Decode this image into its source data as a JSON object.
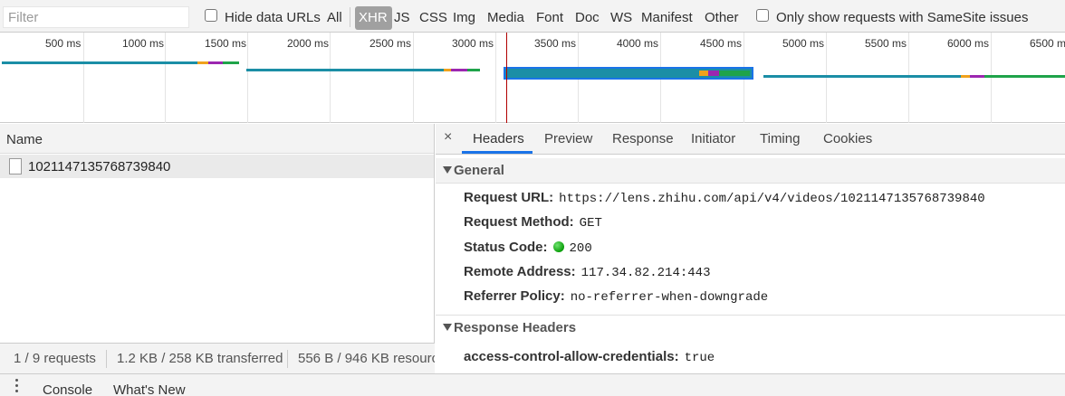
{
  "filter": {
    "placeholder": "Filter",
    "hide_data_urls": "Hide data URLs",
    "types": [
      "All",
      "XHR",
      "JS",
      "CSS",
      "Img",
      "Media",
      "Font",
      "Doc",
      "WS",
      "Manifest",
      "Other"
    ],
    "active_type": "XHR",
    "same_site": "Only show requests with SameSite issues"
  },
  "overview": {
    "ticks": [
      "500 ms",
      "1000 ms",
      "1500 ms",
      "2000 ms",
      "2500 ms",
      "3000 ms",
      "3500 ms",
      "4000 ms",
      "4500 ms",
      "5000 ms",
      "5500 ms",
      "6000 ms",
      "6500 m"
    ]
  },
  "requests": {
    "column_name": "Name",
    "rows": [
      "1021147135768739840"
    ]
  },
  "summary": {
    "requests": "1 / 9 requests",
    "transferred": "1.2 KB / 258 KB transferred",
    "resources": "556 B / 946 KB resourc"
  },
  "details": {
    "close": "×",
    "tabs": [
      "Headers",
      "Preview",
      "Response",
      "Initiator",
      "Timing",
      "Cookies"
    ],
    "active_tab": "Headers",
    "general": {
      "title": "General",
      "fields": [
        {
          "key": "Request URL:",
          "value": "https://lens.zhihu.com/api/v4/videos/1021147135768739840"
        },
        {
          "key": "Request Method:",
          "value": "GET"
        },
        {
          "key": "Status Code:",
          "value": "200"
        },
        {
          "key": "Remote Address:",
          "value": "117.34.82.214:443"
        },
        {
          "key": "Referrer Policy:",
          "value": "no-referrer-when-downgrade"
        }
      ]
    },
    "response_headers": {
      "title": "Response Headers",
      "fields": [
        {
          "key": "access-control-allow-credentials:",
          "value": "true"
        }
      ]
    }
  },
  "drawer": {
    "tabs": [
      "Console",
      "What's New"
    ]
  },
  "colors": {
    "accent": "#1a73e8",
    "status_ok": "#0a9e0a",
    "waterfall_teal": "#1b8ea6",
    "waterfall_green": "#1fa34a",
    "waterfall_orange": "#f0a21c",
    "waterfall_purple": "#9c27b0"
  }
}
